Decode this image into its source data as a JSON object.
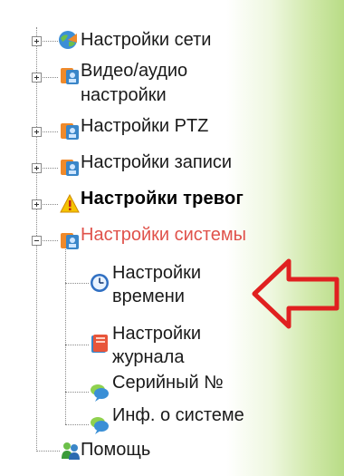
{
  "tree": {
    "items": [
      {
        "label": "Настройки сети",
        "icon": "globe-network-icon",
        "expanded": false
      },
      {
        "label": "Видео/аудио",
        "label2": "настройки",
        "icon": "camera-card-icon",
        "expanded": false
      },
      {
        "label": "Настройки PTZ",
        "icon": "camera-card-icon",
        "expanded": false
      },
      {
        "label": "Настройки записи",
        "icon": "camera-card-icon",
        "expanded": false
      },
      {
        "label": "Настройки тревог",
        "icon": "warning-icon",
        "expanded": false
      },
      {
        "label": "Настройки системы",
        "icon": "camera-card-icon",
        "expanded": true,
        "children": [
          {
            "label": "Настройки",
            "label2": "времени",
            "icon": "clock-icon"
          },
          {
            "label": "Настройки",
            "label2": "журнала",
            "icon": "log-book-icon"
          },
          {
            "label": "Серийный №",
            "icon": "chat-bubble-icon"
          },
          {
            "label": "Инф. о системе",
            "icon": "chat-bubble-icon"
          }
        ]
      },
      {
        "label": "Помощь",
        "icon": "help-people-icon"
      }
    ]
  },
  "colors": {
    "active_label": "#e0524b",
    "arrow": "#e02020",
    "sidebar_gradient_end": "#b8dc86"
  }
}
